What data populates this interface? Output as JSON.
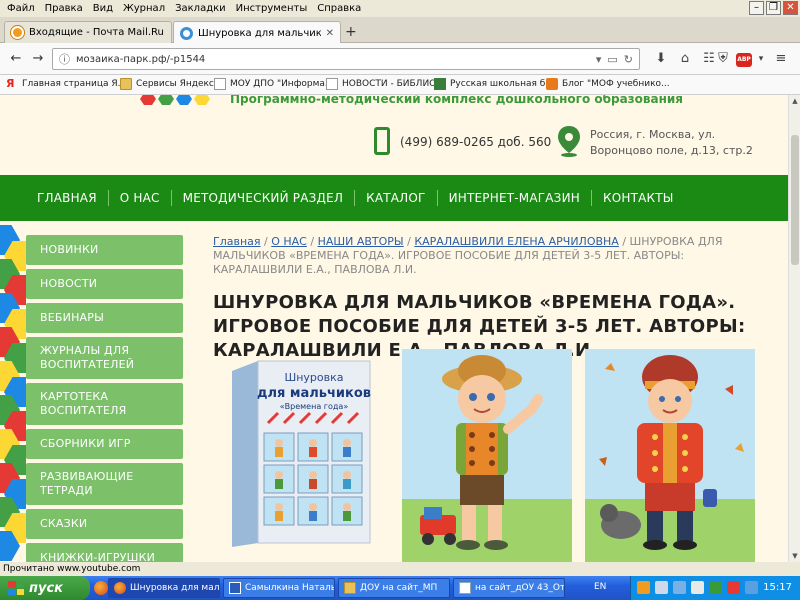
{
  "menubar": {
    "items": [
      "Файл",
      "Правка",
      "Вид",
      "Журнал",
      "Закладки",
      "Инструменты",
      "Справка"
    ]
  },
  "tabs": [
    {
      "title": "Входящие - Почта Mail.Ru",
      "active": false
    },
    {
      "title": "Шнуровка для мальчиков «...",
      "active": true
    }
  ],
  "navbar": {
    "url": "мозаика-парк.рф/-p1544"
  },
  "bookmarks": [
    "Главная страница Я...",
    "Сервисы Яндекса",
    "МОУ ДПО \"Информа...",
    "НОВОСТИ - БИБЛИО...",
    "Русская школьная б...",
    "Блог \"МОФ учебнико..."
  ],
  "site": {
    "tagline": "Программно-методический комплекс дошкольного образования",
    "phone": "(499) 689-0265 доб. 560",
    "address_line1": "Россия, г. Москва, ул.",
    "address_line2": "Воронцово поле, д.13, стр.2"
  },
  "mainnav": [
    "ГЛАВНАЯ",
    "О НАС",
    "МЕТОДИЧЕСКИЙ РАЗДЕЛ",
    "КАТАЛОГ",
    "ИНТЕРНЕТ-МАГАЗИН",
    "КОНТАКТЫ"
  ],
  "sidebar": [
    "НОВИНКИ",
    "НОВОСТИ",
    "ВЕБИНАРЫ",
    "ЖУРНАЛЫ ДЛЯ ВОСПИТАТЕЛЕЙ",
    "КАРТОТЕКА ВОСПИТАТЕЛЯ",
    "СБОРНИКИ ИГР",
    "РАЗВИВАЮЩИЕ ТЕТРАДИ",
    "СКАЗКИ",
    "КНИЖКИ-ИГРУШКИ"
  ],
  "breadcrumb": {
    "links": [
      "Главная",
      "О НАС",
      "НАШИ АВТОРЫ",
      "КАРАЛАШВИЛИ ЕЛЕНА АРЧИЛОВНА"
    ],
    "separator": " / ",
    "current": "ШНУРОВКА ДЛЯ МАЛЬЧИКОВ «ВРЕМЕНА ГОДА». ИГРОВОЕ ПОСОБИЕ ДЛЯ ДЕТЕЙ 3-5 ЛЕТ. АВТОРЫ: КАРАЛАШВИЛИ Е.А., ПАВЛОВА Л.И."
  },
  "product": {
    "title": "ШНУРОВКА ДЛЯ МАЛЬЧИКОВ «ВРЕМЕНА ГОДА». ИГРОВОЕ ПОСОБИЕ ДЛЯ ДЕТЕЙ 3-5 ЛЕТ. АВТОРЫ: КАРАЛАШВИЛИ Е.А., ПАВЛОВА Л.И.",
    "box_line1": "Шнуровка",
    "box_line2": "для мальчиков",
    "box_line3": "«Времена года»"
  },
  "statusbar": {
    "text": "Прочитано www.youtube.com"
  },
  "taskbar": {
    "start_label": "пуск",
    "tasks": [
      "Шнуровка для мальч...",
      "Самылкина Наталья...",
      "ДОУ на сайт_МП",
      "на сайт_дОУ 43_От..."
    ],
    "lang": "EN",
    "clock": "15:17"
  },
  "colors": {
    "nav_green": "#1b8a14",
    "sidebar_green": "#7cc16a",
    "page_bg": "#fff8e6",
    "link_blue": "#2a5ea8"
  }
}
